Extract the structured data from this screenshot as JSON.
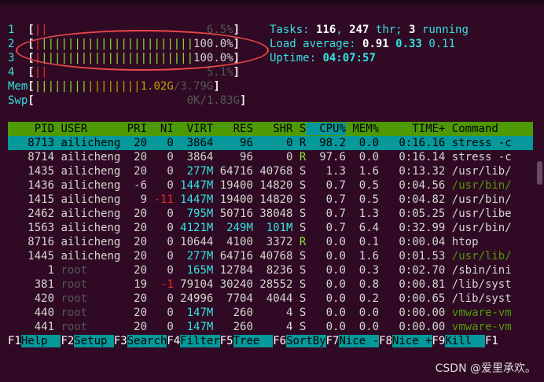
{
  "meters": {
    "cpu": [
      {
        "id": "1",
        "pct": "6.5%"
      },
      {
        "id": "2",
        "pct": "100.0%"
      },
      {
        "id": "3",
        "pct": "100.0%"
      },
      {
        "id": "4",
        "pct": "5.1%"
      }
    ],
    "mem": {
      "label": "Mem",
      "used": "1.02G",
      "total": "/3.79G"
    },
    "swp": {
      "label": "Swp",
      "used": "0K",
      "total": "/1.83G"
    }
  },
  "summary": {
    "tasks_label": "Tasks: ",
    "tasks": "116",
    "thr": "247",
    "thr_label": " thr; ",
    "running": "3",
    "running_label": " running",
    "load_label": "Load average: ",
    "load1": "0.91",
    "load5": "0.33",
    "load15": "0.11",
    "uptime_label": "Uptime: ",
    "uptime": "04:07:57"
  },
  "table": {
    "columns": [
      "PID",
      "USER",
      "PRI",
      "NI",
      "VIRT",
      "RES",
      "SHR",
      "S",
      "CPU%",
      "MEM%",
      "TIME+",
      "Command"
    ],
    "rows": [
      [
        "8713",
        "ailicheng",
        "20",
        "0",
        "3864",
        "96",
        "0",
        "R",
        "98.2",
        "0.0",
        "0:16.16",
        "stress -c"
      ],
      [
        "8714",
        "ailicheng",
        "20",
        "0",
        "3864",
        "96",
        "0",
        "R",
        "97.6",
        "0.0",
        "0:16.14",
        "stress -c"
      ],
      [
        "1435",
        "ailicheng",
        "20",
        "0",
        "277M",
        "64716",
        "40768",
        "S",
        "1.3",
        "1.6",
        "0:13.32",
        "/usr/lib/"
      ],
      [
        "1436",
        "ailicheng",
        "-6",
        "0",
        "1447M",
        "19400",
        "14820",
        "S",
        "0.7",
        "0.5",
        "0:04.56",
        "/usr/bin/"
      ],
      [
        "1415",
        "ailicheng",
        "9",
        "-11",
        "1447M",
        "19400",
        "14820",
        "S",
        "0.7",
        "0.5",
        "0:04.82",
        "/usr/bin/"
      ],
      [
        "2462",
        "ailicheng",
        "20",
        "0",
        "795M",
        "50716",
        "38048",
        "S",
        "0.7",
        "1.3",
        "0:05.25",
        "/usr/libe"
      ],
      [
        "1563",
        "ailicheng",
        "20",
        "0",
        "4121M",
        "249M",
        "101M",
        "S",
        "0.7",
        "6.4",
        "0:32.99",
        "/usr/bin/"
      ],
      [
        "8716",
        "ailicheng",
        "20",
        "0",
        "10644",
        "4100",
        "3372",
        "R",
        "0.0",
        "0.1",
        "0:00.04",
        "htop"
      ],
      [
        "1445",
        "ailicheng",
        "20",
        "0",
        "277M",
        "64716",
        "40768",
        "S",
        "0.0",
        "1.6",
        "0:01.53",
        "/usr/lib/"
      ],
      [
        "1",
        "root",
        "20",
        "0",
        "165M",
        "12784",
        "8236",
        "S",
        "0.0",
        "0.3",
        "0:02.70",
        "/sbin/ini"
      ],
      [
        "381",
        "root",
        "19",
        "-1",
        "79104",
        "30240",
        "28552",
        "S",
        "0.0",
        "0.8",
        "0:00.81",
        "/lib/syst"
      ],
      [
        "420",
        "root",
        "20",
        "0",
        "24996",
        "7704",
        "4044",
        "S",
        "0.0",
        "0.2",
        "0:00.65",
        "/lib/syst"
      ],
      [
        "440",
        "root",
        "20",
        "0",
        "147M",
        "260",
        "4",
        "S",
        "0.0",
        "0.0",
        "0:00.00",
        "vmware-vm"
      ],
      [
        "441",
        "root",
        "20",
        "0",
        "147M",
        "260",
        "4",
        "S",
        "0.0",
        "0.0",
        "0:00.00",
        "vmware-vm"
      ]
    ]
  },
  "footer": [
    {
      "key": "F1",
      "label": "Help  "
    },
    {
      "key": "F2",
      "label": "Setup "
    },
    {
      "key": "F3",
      "label": "Search"
    },
    {
      "key": "F4",
      "label": "Filter"
    },
    {
      "key": "F5",
      "label": "Tree  "
    },
    {
      "key": "F6",
      "label": "SortBy"
    },
    {
      "key": "F7",
      "label": "Nice -"
    },
    {
      "key": "F8",
      "label": "Nice +"
    },
    {
      "key": "F9",
      "label": "Kill  "
    },
    {
      "key": "F1",
      "label": ""
    }
  ],
  "watermark": "CSDN @爱里承欢。",
  "colors": {
    "bg": "#300a24",
    "header": "#4e9a06",
    "selected": "#06989a",
    "annotation": "#e8484a"
  }
}
